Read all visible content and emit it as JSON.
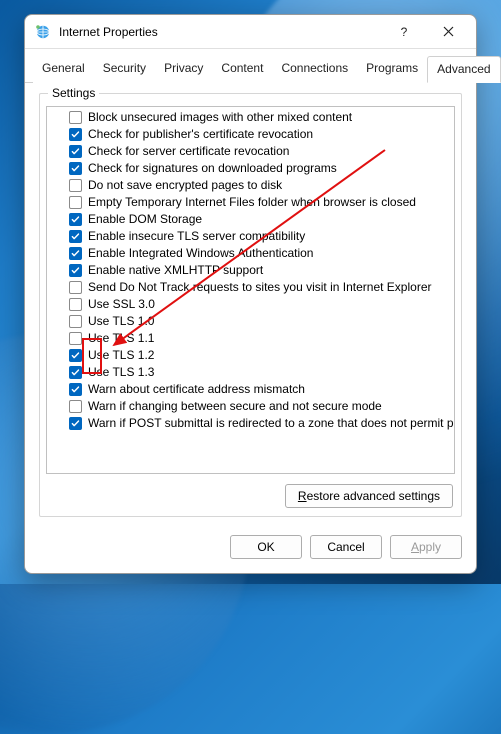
{
  "window": {
    "title": "Internet Properties"
  },
  "tabs": [
    {
      "label": "General"
    },
    {
      "label": "Security"
    },
    {
      "label": "Privacy"
    },
    {
      "label": "Content"
    },
    {
      "label": "Connections"
    },
    {
      "label": "Programs"
    },
    {
      "label": "Advanced",
      "active": true
    }
  ],
  "group": {
    "label": "Settings"
  },
  "settings": [
    {
      "checked": false,
      "label": "Block unsecured images with other mixed content"
    },
    {
      "checked": true,
      "label": "Check for publisher's certificate revocation"
    },
    {
      "checked": true,
      "label": "Check for server certificate revocation"
    },
    {
      "checked": true,
      "label": "Check for signatures on downloaded programs"
    },
    {
      "checked": false,
      "label": "Do not save encrypted pages to disk"
    },
    {
      "checked": false,
      "label": "Empty Temporary Internet Files folder when browser is closed"
    },
    {
      "checked": true,
      "label": "Enable DOM Storage"
    },
    {
      "checked": true,
      "label": "Enable insecure TLS server compatibility"
    },
    {
      "checked": true,
      "label": "Enable Integrated Windows Authentication"
    },
    {
      "checked": true,
      "label": "Enable native XMLHTTP support"
    },
    {
      "checked": false,
      "label": "Send Do Not Track requests to sites you visit in Internet Explorer"
    },
    {
      "checked": false,
      "label": "Use SSL 3.0"
    },
    {
      "checked": false,
      "label": "Use TLS 1.0"
    },
    {
      "checked": false,
      "label": "Use TLS 1.1"
    },
    {
      "checked": true,
      "label": "Use TLS 1.2",
      "highlight": true
    },
    {
      "checked": true,
      "label": "Use TLS 1.3",
      "highlight": true
    },
    {
      "checked": true,
      "label": "Warn about certificate address mismatch"
    },
    {
      "checked": false,
      "label": "Warn if changing between secure and not secure mode"
    },
    {
      "checked": true,
      "label": "Warn if POST submittal is redirected to a zone that does not permit posts"
    }
  ],
  "buttons": {
    "restore": "Restore advanced settings",
    "restore_accel": "R",
    "ok": "OK",
    "cancel": "Cancel",
    "apply": "Apply",
    "apply_accel": "A"
  },
  "colors": {
    "accent": "#0067c0",
    "annotation": "#e01010"
  }
}
